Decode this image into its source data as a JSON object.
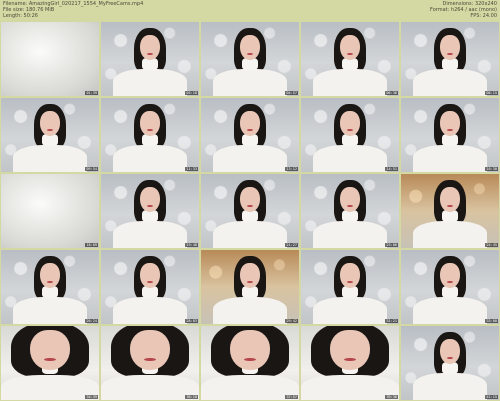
{
  "header": {
    "filename": "Filename: AmazingGirl_020217_1554_MyFreeCams.mp4",
    "filesize": "File size: 180.76 MiB",
    "length": "Length: 50:26",
    "dimensions": "Dimensions: 320x240",
    "format": "Format: h264 / aac (mono)",
    "fps": "FPS: 24.00"
  },
  "thumbnails": [
    {
      "style": "blur",
      "time": "01:39"
    },
    {
      "style": "",
      "time": "03:18"
    },
    {
      "style": "",
      "time": "04:57"
    },
    {
      "style": "",
      "time": "06:36"
    },
    {
      "style": "",
      "time": "08:15"
    },
    {
      "style": "",
      "time": "09:54"
    },
    {
      "style": "",
      "time": "11:33"
    },
    {
      "style": "",
      "time": "13:12"
    },
    {
      "style": "",
      "time": "14:51"
    },
    {
      "style": "",
      "time": "16:30"
    },
    {
      "style": "blur",
      "time": "18:09"
    },
    {
      "style": "",
      "time": "19:48"
    },
    {
      "style": "",
      "time": "21:27"
    },
    {
      "style": "",
      "time": "23:06"
    },
    {
      "style": "warm",
      "time": "24:45"
    },
    {
      "style": "",
      "time": "26:24"
    },
    {
      "style": "",
      "time": "28:03"
    },
    {
      "style": "warm",
      "time": "29:42"
    },
    {
      "style": "",
      "time": "31:21"
    },
    {
      "style": "",
      "time": "33:00"
    },
    {
      "style": "warm close",
      "time": "34:39"
    },
    {
      "style": "close",
      "time": "36:18"
    },
    {
      "style": "warm close",
      "time": "37:57"
    },
    {
      "style": "close",
      "time": "39:36"
    },
    {
      "style": "",
      "time": "41:15"
    }
  ]
}
